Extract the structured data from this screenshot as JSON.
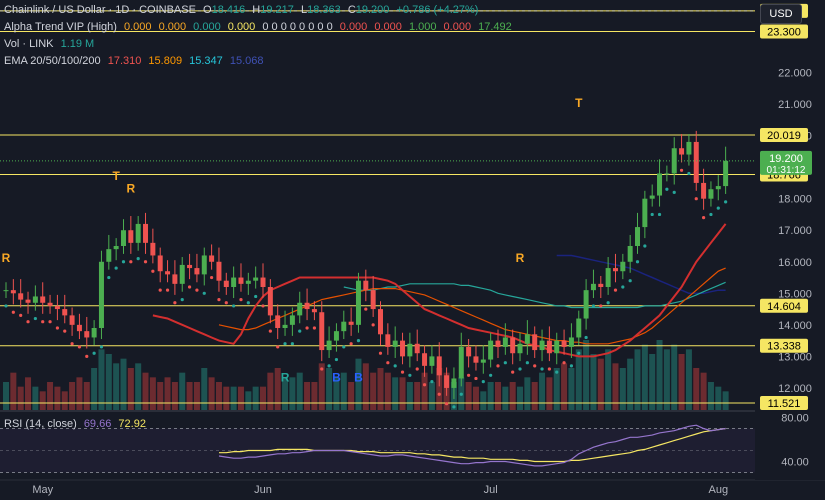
{
  "legend": {
    "symbol": "Chainlink / US Dollar · 1D · COINBASE",
    "open_label": "O",
    "open": "18.416",
    "high_label": "H",
    "high": "19.217",
    "low_label": "L",
    "low": "18.363",
    "close_label": "C",
    "close": "19.200",
    "change": "+0.786 (+4.27%)",
    "alpha_label": "Alpha Trend VIP (High)",
    "alpha_values": [
      "0.000",
      "0.000",
      "0.000",
      "0.000",
      "0 0 0 0 0 0 0 0",
      "0.000",
      "0.000",
      "1.000",
      "0.000",
      "17.492"
    ],
    "vol_label": "Vol · LINK",
    "vol_value": "1.19 M",
    "ema_label": "EMA 20/50/100/200",
    "ema_values": [
      "17.310",
      "15.809",
      "15.347",
      "15.068"
    ]
  },
  "currency": "USD",
  "rsi_legend": {
    "label": "RSI (14, close)",
    "v1": "69.66",
    "v2": "72.92"
  },
  "colors": {
    "bg": "#161a25",
    "up": "#26a69a",
    "up_bright": "#4caf50",
    "down": "#ef5350",
    "ema20": "#d32f2f",
    "ema50": "#e65100",
    "ema100": "#26a69a",
    "ema200": "#1a237e",
    "level": "#f5e663",
    "rsi": "#7e57c2",
    "rsi_ma": "#f5e663",
    "text": "#d1d4dc"
  },
  "chart_data": {
    "type": "candlestick",
    "ylim": [
      11.3,
      24.3
    ],
    "y_ticks": [
      "22.000",
      "21.000",
      "20.000",
      "19.000",
      "18.000",
      "17.000",
      "16.000",
      "15.000",
      "14.000",
      "13.000",
      "12.000"
    ],
    "price_labels": [
      {
        "value": 23.955,
        "text": "23.955",
        "style": "level"
      },
      {
        "value": 23.3,
        "text": "23.300",
        "style": "level"
      },
      {
        "value": 20.019,
        "text": "20.019",
        "style": "level"
      },
      {
        "value": 18.766,
        "text": "18.766",
        "style": "level"
      },
      {
        "value": 14.604,
        "text": "14.604",
        "style": "level"
      },
      {
        "value": 13.338,
        "text": "13.338",
        "style": "level"
      },
      {
        "value": 11.521,
        "text": "11.521",
        "style": "level"
      }
    ],
    "current_price": {
      "value": 19.2,
      "text": "19.200",
      "countdown": "01:31:12"
    },
    "x_ticks": [
      {
        "label": "May",
        "index": 5
      },
      {
        "label": "Jun",
        "index": 35
      },
      {
        "label": "Jul",
        "index": 66
      },
      {
        "label": "Aug",
        "index": 97
      }
    ],
    "closes": [
      15.1,
      15.0,
      14.8,
      14.7,
      14.9,
      14.7,
      14.6,
      14.5,
      14.3,
      14.0,
      13.8,
      13.6,
      13.9,
      16.0,
      16.4,
      16.5,
      17.0,
      16.6,
      17.2,
      16.6,
      16.2,
      15.7,
      15.6,
      15.3,
      15.9,
      15.8,
      15.6,
      16.2,
      16.0,
      15.4,
      15.2,
      15.5,
      15.3,
      15.4,
      15.5,
      15.2,
      14.3,
      13.9,
      14.0,
      14.3,
      14.7,
      14.5,
      14.4,
      13.2,
      13.5,
      13.8,
      14.1,
      14.0,
      15.4,
      15.1,
      14.5,
      13.7,
      13.3,
      13.5,
      13.0,
      13.4,
      13.1,
      12.7,
      13.0,
      12.4,
      12.0,
      12.3,
      13.3,
      13.0,
      12.8,
      12.9,
      13.5,
      13.3,
      13.6,
      13.1,
      13.4,
      13.7,
      13.2,
      13.5,
      13.1,
      13.5,
      13.3,
      13.6,
      14.2,
      15.1,
      15.3,
      15.2,
      15.8,
      15.7,
      16.0,
      16.5,
      17.1,
      18.0,
      18.1,
      18.8,
      18.8,
      19.6,
      19.4,
      19.8,
      18.5,
      18.0,
      18.3,
      18.4,
      19.2
    ],
    "ema20": [
      14.3,
      14.25,
      14.2,
      14.1,
      14.0,
      13.9,
      13.8,
      13.7,
      13.6,
      13.5,
      13.45,
      13.4,
      13.7,
      14.2,
      14.6,
      14.9,
      15.1,
      15.2,
      15.3,
      15.4,
      15.5,
      15.5,
      15.5,
      15.5,
      15.5,
      15.5,
      15.5,
      15.5,
      15.5,
      15.5,
      15.5,
      15.45,
      15.4,
      15.3,
      15.1,
      14.9,
      14.7,
      14.5,
      14.4,
      14.3,
      14.2,
      14.1,
      14.0,
      13.9,
      13.85,
      13.8,
      13.75,
      13.7,
      13.65,
      13.6,
      13.5,
      13.4,
      13.35,
      13.3,
      13.2,
      13.15,
      13.1,
      13.05,
      13.0,
      13.0,
      13.0,
      13.05,
      13.1,
      13.2,
      13.35,
      13.5,
      13.7,
      13.9,
      14.1,
      14.3,
      14.6,
      14.9,
      15.2,
      15.6,
      16.0,
      16.3,
      16.6,
      16.9,
      17.2
    ],
    "ema50": [
      14.0,
      13.95,
      13.9,
      13.85,
      13.85,
      13.9,
      14.0,
      14.1,
      14.2,
      14.3,
      14.4,
      14.5,
      14.6,
      14.7,
      14.8,
      14.85,
      14.9,
      14.95,
      15.0,
      15.05,
      15.1,
      15.15,
      15.15,
      15.15,
      15.15,
      15.1,
      15.05,
      15.0,
      14.95,
      14.85,
      14.75,
      14.65,
      14.55,
      14.45,
      14.35,
      14.25,
      14.15,
      14.05,
      13.95,
      13.85,
      13.8,
      13.75,
      13.7,
      13.65,
      13.6,
      13.55,
      13.5,
      13.5,
      13.45,
      13.45,
      13.4,
      13.4,
      13.4,
      13.4,
      13.45,
      13.5,
      13.55,
      13.65,
      13.75,
      13.9,
      14.1,
      14.3,
      14.5,
      14.7,
      14.9,
      15.1,
      15.3,
      15.5,
      15.7,
      15.8
    ],
    "ema100": [
      15.2,
      15.15,
      15.1,
      15.1,
      15.1,
      15.15,
      15.2,
      15.2,
      15.25,
      15.3,
      15.3,
      15.3,
      15.3,
      15.3,
      15.3,
      15.3,
      15.25,
      15.25,
      15.2,
      15.15,
      15.1,
      15.0,
      14.95,
      14.9,
      14.85,
      14.8,
      14.75,
      14.7,
      14.65,
      14.6,
      14.6,
      14.55,
      14.55,
      14.55,
      14.55,
      14.55,
      14.55,
      14.55,
      14.55,
      14.55,
      14.55,
      14.6,
      14.6,
      14.6,
      14.65,
      14.7,
      14.75,
      14.85,
      14.95,
      15.05,
      15.15,
      15.25,
      15.35
    ],
    "ema200": [
      16.2,
      16.2,
      16.2,
      16.15,
      16.1,
      16.05,
      16.0,
      15.95,
      15.9,
      15.85,
      15.8,
      15.7,
      15.6,
      15.5,
      15.4,
      15.3,
      15.2,
      15.1,
      15.0,
      15.0,
      15.0,
      15.05,
      15.1,
      15.1
    ],
    "signals": [
      {
        "text": "T",
        "index": 15,
        "value": 18.6,
        "color": "#f9a825"
      },
      {
        "text": "R",
        "index": 17,
        "value": 18.2,
        "color": "#f9a825"
      },
      {
        "text": "R",
        "index": 0,
        "value": 16.0,
        "color": "#f9a825"
      },
      {
        "text": "R",
        "index": 38,
        "value": 12.2,
        "color": "#26a69a"
      },
      {
        "text": "B",
        "index": 45,
        "value": 12.2,
        "color": "#2962ff"
      },
      {
        "text": "B",
        "index": 48,
        "value": 12.2,
        "color": "#2962ff"
      },
      {
        "text": "R",
        "index": 70,
        "value": 16.0,
        "color": "#f9a825"
      },
      {
        "text": "T",
        "index": 78,
        "value": 20.9,
        "color": "#f9a825"
      }
    ],
    "volumes": [
      0.6,
      0.8,
      0.5,
      0.7,
      0.5,
      0.4,
      0.6,
      0.5,
      0.4,
      0.6,
      0.7,
      0.6,
      0.9,
      1.3,
      1.2,
      1.0,
      1.1,
      0.9,
      1.0,
      0.8,
      0.7,
      0.6,
      0.7,
      0.6,
      0.8,
      0.6,
      0.6,
      0.9,
      0.7,
      0.6,
      0.5,
      0.5,
      0.5,
      0.4,
      0.5,
      0.5,
      0.8,
      0.9,
      0.7,
      0.7,
      0.8,
      0.6,
      0.6,
      1.0,
      0.9,
      0.7,
      0.8,
      0.6,
      1.1,
      1.0,
      0.8,
      0.9,
      0.8,
      0.7,
      0.7,
      0.6,
      0.6,
      0.8,
      0.6,
      0.9,
      0.8,
      0.6,
      0.7,
      0.6,
      0.5,
      0.4,
      0.6,
      0.6,
      0.5,
      0.6,
      0.5,
      0.7,
      0.6,
      0.8,
      0.7,
      0.9,
      1.0,
      0.9,
      1.3,
      1.5,
      1.2,
      1.1,
      1.3,
      1.0,
      0.9,
      1.1,
      1.3,
      1.4,
      1.2,
      1.5,
      1.3,
      1.4,
      1.2,
      1.3,
      0.9,
      0.8,
      0.6,
      0.5,
      0.4
    ],
    "rsi": [
      45,
      44,
      43,
      43,
      44,
      44,
      45,
      46,
      47,
      47,
      48,
      48,
      49,
      50,
      50,
      50,
      50,
      50,
      49,
      48,
      47,
      46,
      45,
      45,
      46,
      46,
      45,
      44,
      43,
      42,
      41,
      40,
      39,
      38,
      38,
      39,
      39,
      40,
      40,
      40,
      39,
      38,
      37,
      36,
      36,
      37,
      38,
      39,
      42,
      47,
      50,
      53,
      55,
      57,
      58,
      60,
      62,
      62,
      63,
      64,
      66,
      67,
      68,
      70,
      72,
      73,
      70,
      68,
      69,
      70
    ],
    "rsi_ma": [
      48,
      48,
      49,
      49,
      50,
      50,
      50,
      50,
      51,
      51,
      51,
      51,
      51,
      50,
      50,
      50,
      50,
      50,
      50,
      49,
      49,
      49,
      48,
      48,
      48,
      48,
      48,
      47,
      47,
      46,
      46,
      45,
      44,
      44,
      43,
      43,
      43,
      42,
      42,
      42,
      42,
      41,
      41,
      40,
      40,
      40,
      40,
      40,
      41,
      41,
      42,
      43,
      44,
      45,
      46,
      47,
      48,
      50,
      51,
      53,
      55,
      57,
      59,
      61,
      63,
      65,
      67,
      68,
      69,
      70
    ],
    "rsi_ticks": [
      "80.00",
      "40.00"
    ],
    "rsi_ylim": [
      25,
      85
    ]
  }
}
